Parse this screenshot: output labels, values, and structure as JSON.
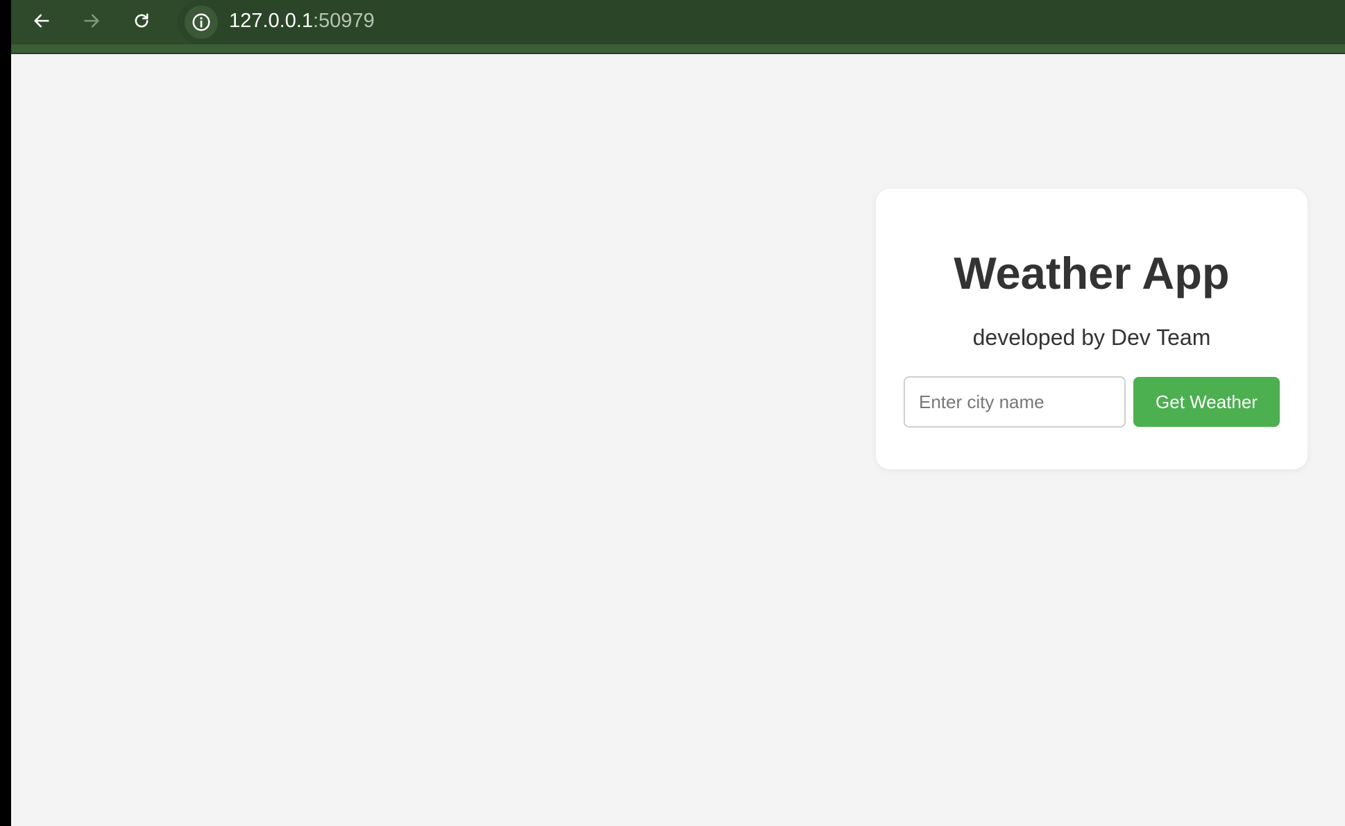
{
  "browser": {
    "back_icon": "arrow-left-icon",
    "forward_icon": "arrow-right-icon",
    "reload_icon": "reload-icon",
    "site_info_icon": "info-icon",
    "url_host": "127.0.0.1",
    "url_port": ":50979",
    "toolbar_color": "#2e4a2b"
  },
  "card": {
    "title": "Weather App",
    "subtitle": "developed by Dev Team",
    "city_input": {
      "placeholder": "Enter city name",
      "value": ""
    },
    "button_label": "Get Weather",
    "button_color": "#4caf50"
  },
  "page": {
    "background": "#f4f4f4"
  }
}
